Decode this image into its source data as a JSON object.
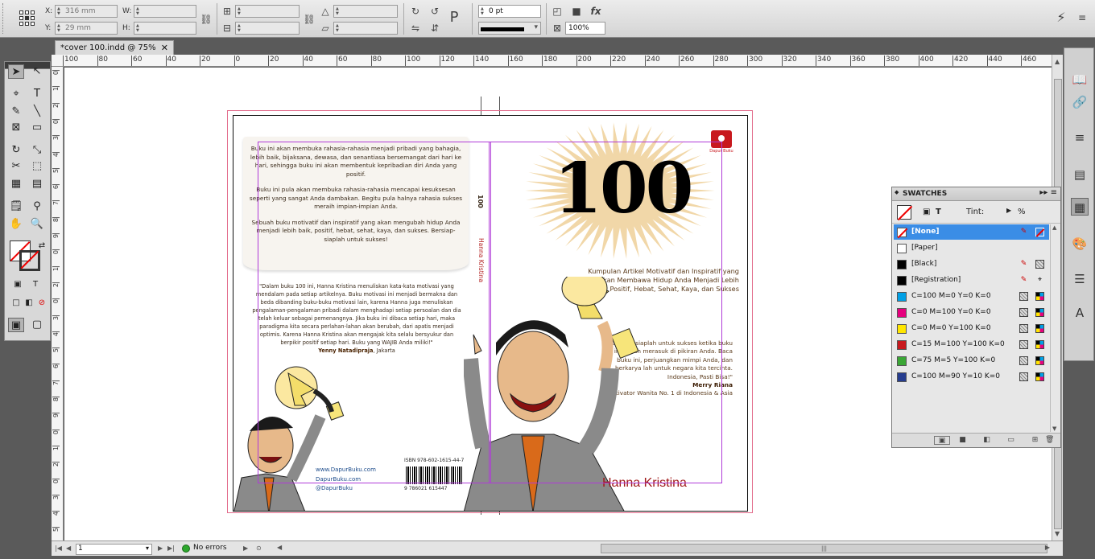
{
  "control_bar": {
    "x_label": "X:",
    "y_label": "Y:",
    "w_label": "W:",
    "h_label": "H:",
    "x_value": "316 mm",
    "y_value": "29 mm",
    "stroke_weight": "0 pt",
    "opacity": "100%"
  },
  "document": {
    "tab_title": "*cover 100.indd @ 75%",
    "close_glyph": "✕"
  },
  "ruler": {
    "top_ticks": [
      "100",
      "80",
      "60",
      "40",
      "20",
      "0",
      "20",
      "40",
      "60",
      "80",
      "100",
      "120",
      "140",
      "160",
      "180",
      "200",
      "220",
      "240",
      "260",
      "280",
      "300",
      "320",
      "340",
      "360",
      "380",
      "400",
      "420",
      "440",
      "460"
    ],
    "left_ticks": [
      "0",
      "1",
      "2",
      "0",
      "3",
      "4",
      "5",
      "6",
      "7",
      "8",
      "9",
      "0",
      "1",
      "2",
      "0",
      "3",
      "4",
      "5",
      "6",
      "7",
      "8",
      "9",
      "0",
      "1",
      "2",
      "0",
      "3",
      "4",
      "5"
    ]
  },
  "cover": {
    "back_blurb": [
      "Buku ini akan membuka rahasia-rahasia menjadi pribadi yang bahagia, lebih baik, bijaksana, dewasa, dan senantiasa bersemangat dari hari ke hari, sehingga buku ini akan membentuk kepribadian diri Anda yang positif.",
      "Buku ini pula akan membuka rahasia-rahasia mencapai kesuksesan seperti yang sangat Anda dambakan. Begitu pula halnya rahasia sukses meraih impian-impian Anda.",
      "Sebuah buku motivatif dan inspiratif yang akan mengubah hidup Anda menjadi lebih baik, positif, hebat, sehat, kaya, dan sukses. Bersiap-siaplah untuk sukses!"
    ],
    "back_quote": "\"Dalam buku 100 ini, Hanna Kristina menuliskan kata-kata motivasi yang mendalam pada setiap artikelnya. Buku motivasi ini menjadi bermakna dan beda dibanding buku-buku motivasi lain, karena Hanna juga menuliskan pengalaman-pengalaman pribadi dalam menghadapi setiap persoalan dan dia telah keluar sebagai pemenangnya. Jika buku ini dibaca setiap hari, maka paradigma kita secara perlahan-lahan akan berubah, dari apatis menjadi optimis. Karena Hanna Kristina akan mengajak kita selalu bersyukur dan berpikir positif setiap hari. Buku yang WAJIB Anda miliki!\"",
    "back_quote_author": "Yenny Natadipraja",
    "back_quote_city": ", Jakarta",
    "contacts": [
      "www.DapurBuku.com",
      "DapurBuku.com",
      "@DapurBuku"
    ],
    "isbn": "ISBN 978-602-1615-44-7",
    "barcode_number": "9 786021 615447",
    "spine_title": "100",
    "spine_author": "Hanna Kristina",
    "title": "100",
    "subtitle": "Kumpulan Artikel Motivatif dan Inspiratif yang akan Membawa Hidup Anda Menjadi Lebih Baik, Positif, Hebat, Sehat, Kaya, dan Sukses",
    "front_quote": "\"Bersiap-siaplah untuk sukses ketika buku ini sudah merasuk di pikiran Anda. Baca buku ini, perjuangkan mimpi Anda, dan berkarya lah untuk negara kita tercinta. Indonesia, Pasti Bisa!\"",
    "front_quote_author": "Merry Riana",
    "front_quote_role": "Motivator Wanita No. 1 di Indonesia & Asia",
    "author": "Hanna Kristina",
    "publisher": "Dapur Buku"
  },
  "swatches": {
    "title": "SWATCHES",
    "tint_label": "Tint:",
    "tint_unit": "%",
    "items": [
      {
        "name": "[None]",
        "color": "#ffffff"
      },
      {
        "name": "[Paper]",
        "color": "#ffffff"
      },
      {
        "name": "[Black]",
        "color": "#000000"
      },
      {
        "name": "[Registration]",
        "color": "#000000"
      },
      {
        "name": "C=100 M=0 Y=0 K=0",
        "color": "#00a0e6"
      },
      {
        "name": "C=0 M=100 Y=0 K=0",
        "color": "#e6007e"
      },
      {
        "name": "C=0 M=0 Y=100 K=0",
        "color": "#ffe600"
      },
      {
        "name": "C=15 M=100 Y=100 K=0",
        "color": "#c8191e"
      },
      {
        "name": "C=75 M=5 Y=100 K=0",
        "color": "#3aa635"
      },
      {
        "name": "C=100 M=90 Y=10 K=0",
        "color": "#263d8f"
      }
    ]
  },
  "status_bar": {
    "page": "1",
    "preflight": "No errors"
  }
}
